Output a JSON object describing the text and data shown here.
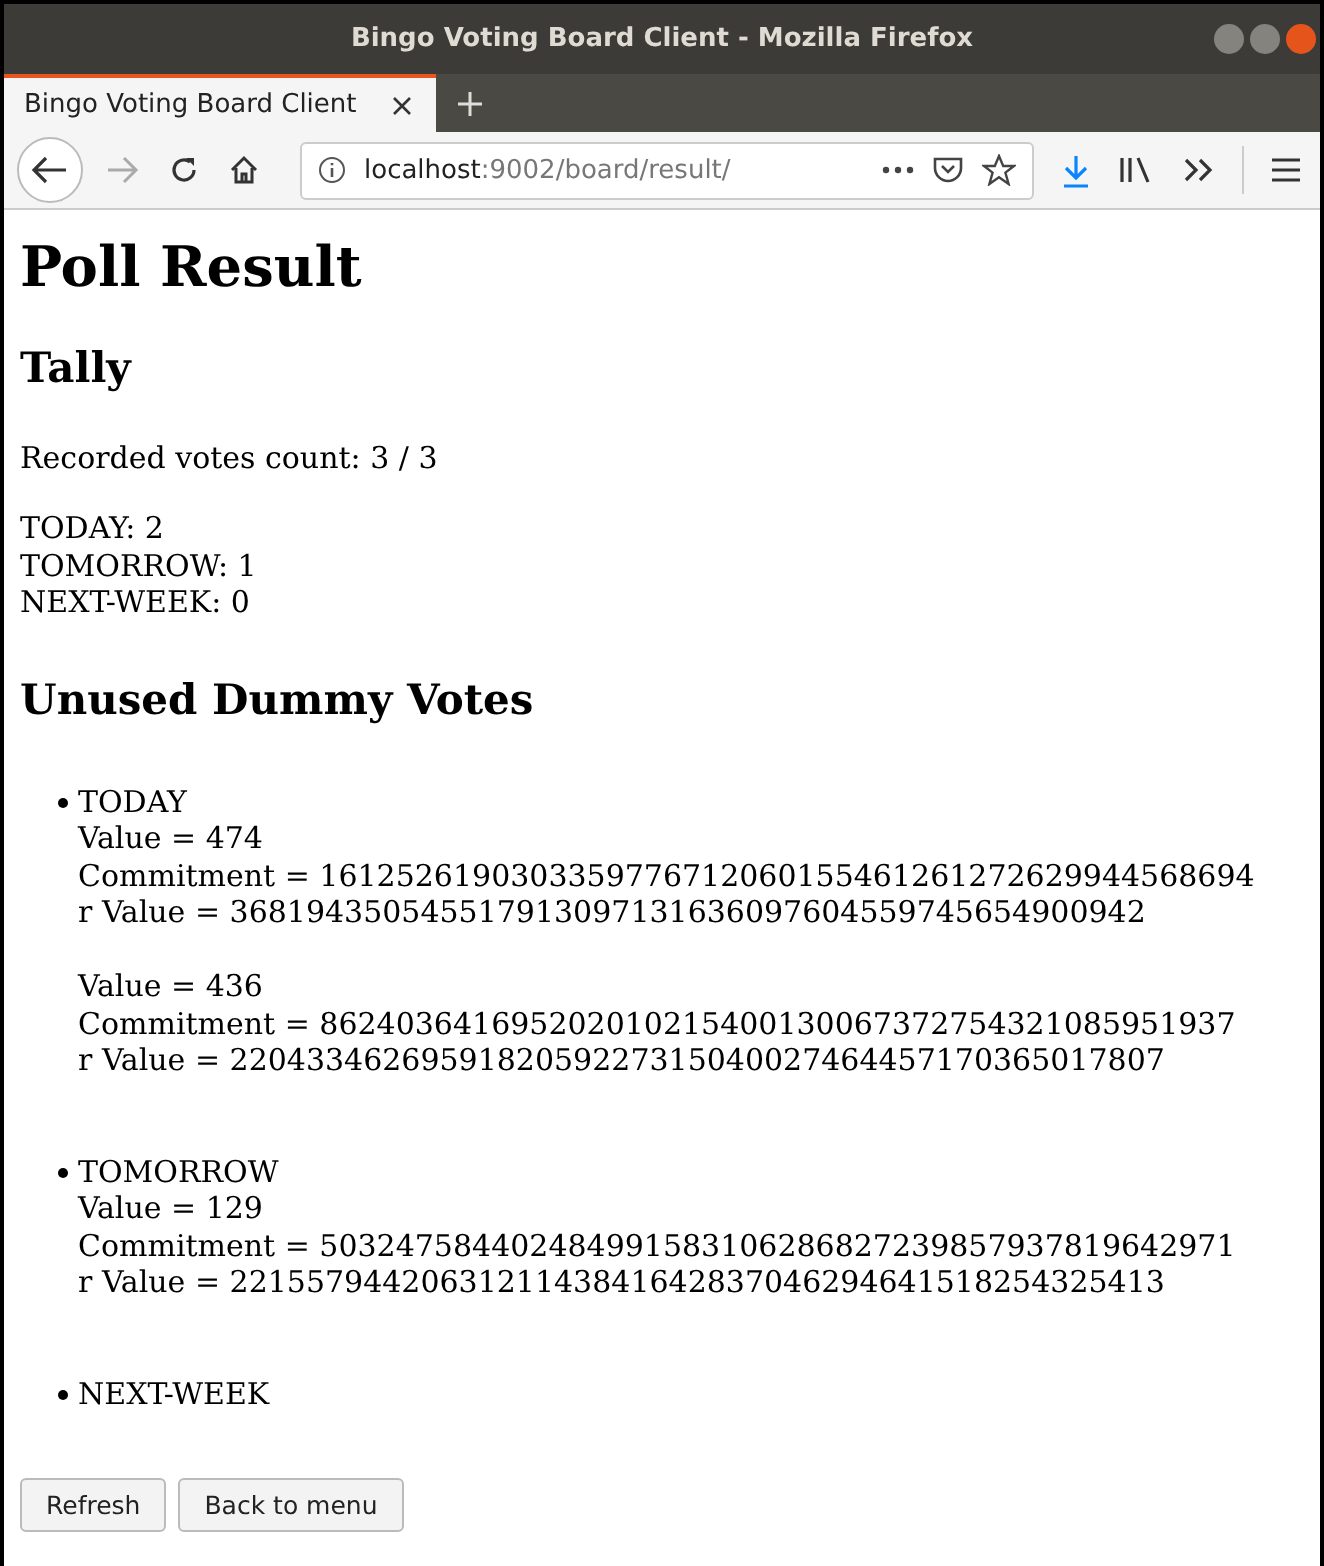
{
  "window": {
    "title": "Bingo Voting Board Client - Mozilla Firefox"
  },
  "tabs": [
    {
      "label": "Bingo Voting Board Client",
      "selected": true
    }
  ],
  "address_bar": {
    "host": "localhost",
    "path": ":9002/board/result/"
  },
  "page": {
    "title": "Poll Result",
    "tally": {
      "heading": "Tally",
      "count": "Recorded votes count: 3 / 3",
      "results": [
        "TODAY: 2",
        "TOMORROW: 1",
        "NEXT-WEEK: 0"
      ]
    },
    "unused": {
      "heading": "Unused Dummy Votes",
      "groups": [
        {
          "option": "TODAY",
          "votes": [
            {
              "value": "Value = 474",
              "commitment": "Commitment = 1612526190303359776712060155461261272629944568694",
              "r_value": "r Value = 368194350545517913097131636097604559745654900942"
            },
            {
              "value": "Value = 436",
              "commitment": "Commitment = 862403641695202010215400130067372754321085951937",
              "r_value": "r Value = 2204334626959182059227315040027464457170365017807"
            }
          ]
        },
        {
          "option": "TOMORROW",
          "votes": [
            {
              "value": "Value = 129",
              "commitment": "Commitment = 503247584402484991583106286827239857937819642971",
              "r_value": "r Value = 2215579442063121143841642837046294641518254325413"
            }
          ]
        },
        {
          "option": "NEXT-WEEK"
        }
      ]
    },
    "buttons": [
      "Refresh",
      "Back to menu"
    ]
  }
}
